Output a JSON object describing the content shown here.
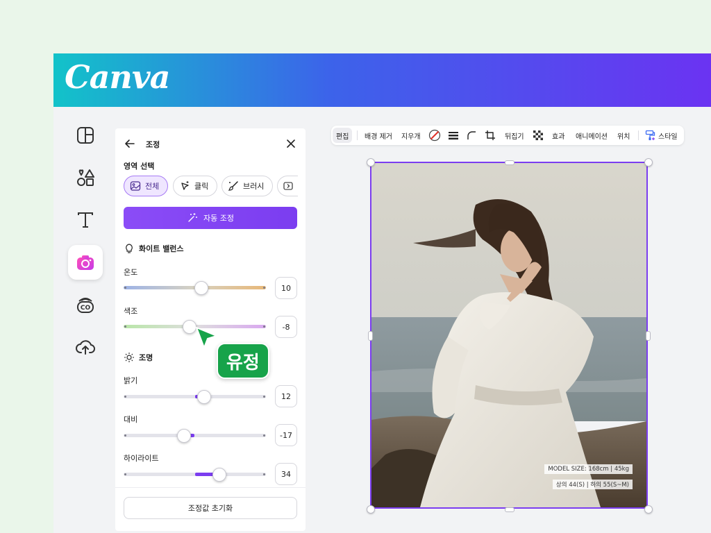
{
  "app": {
    "logo": "Canva"
  },
  "rail": {
    "items": [
      {
        "name": "layout-icon"
      },
      {
        "name": "elements-icon"
      },
      {
        "name": "text-icon"
      },
      {
        "name": "camera-icon",
        "active": true
      },
      {
        "name": "brand-cc-icon"
      },
      {
        "name": "upload-cloud-icon"
      }
    ]
  },
  "panel": {
    "title": "조정",
    "region_label": "영역 선택",
    "chips": [
      "전체",
      "클릭",
      "브러시"
    ],
    "auto_button": "자동 조정",
    "white_balance": {
      "heading": "화이트 밸런스",
      "temperature": {
        "label": "온도",
        "value": "10"
      },
      "tint": {
        "label": "색조",
        "value": "-8"
      }
    },
    "lighting": {
      "heading": "조명",
      "brightness": {
        "label": "밝기",
        "value": "12"
      },
      "contrast": {
        "label": "대비",
        "value": "-17"
      },
      "highlights": {
        "label": "하이라이트",
        "value": "34"
      }
    },
    "reset_button": "조정값 초기화"
  },
  "cursor_tag": "유정",
  "toolbar": {
    "edit": "편집",
    "bg_remove": "배경 제거",
    "eraser": "지우개",
    "flip": "뒤집기",
    "effects": "효과",
    "animation": "애니메이션",
    "position": "위치",
    "style": "스타일"
  },
  "photo": {
    "size_line1": "MODEL SIZE: 168cm | 45kg",
    "size_line2": "상의 44(S)  |  하의 55(S~M)"
  },
  "colors": {
    "accent": "#7b3df0",
    "cursor_green": "#17a34a"
  }
}
